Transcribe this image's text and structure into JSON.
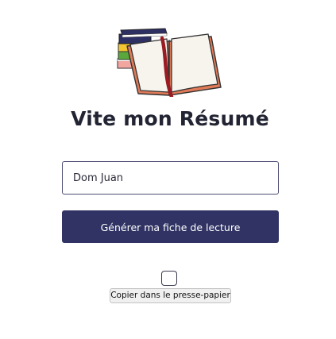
{
  "app": {
    "title": "Vite mon Résumé",
    "logo_icon": "open-book-with-stack-of-books-icon"
  },
  "form": {
    "title_input": {
      "value": "Dom Juan",
      "placeholder": ""
    },
    "generate_label": "Générer ma fiche de lecture",
    "copy_label": "Copier dans le presse-papier",
    "copy_checkbox_checked": false
  },
  "colors": {
    "primary": "#303363",
    "title_text": "#222433",
    "book_cover": "#e07a57",
    "bookmark": "#9b1b22"
  }
}
